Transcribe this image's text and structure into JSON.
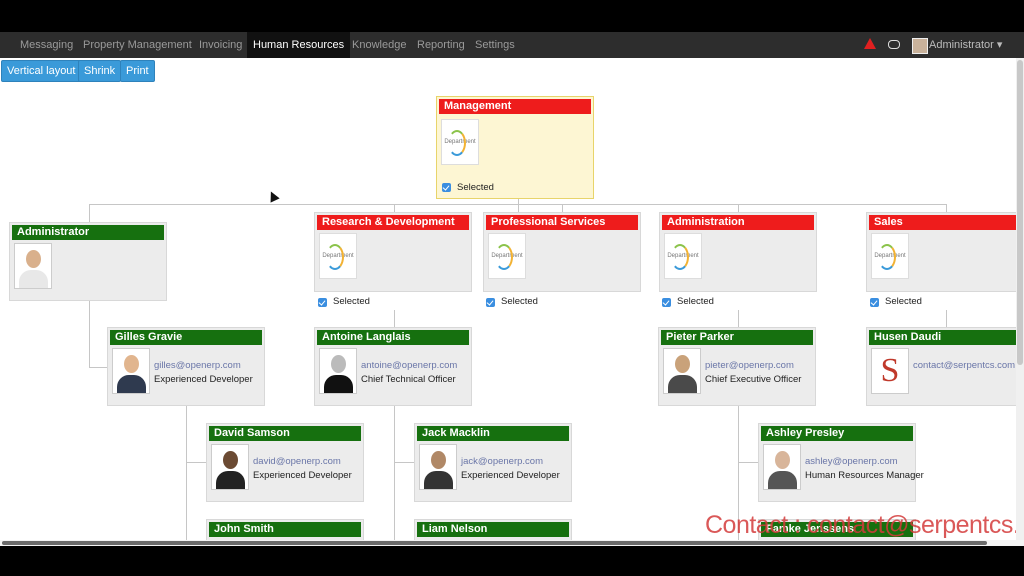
{
  "nav": {
    "items": [
      "Messaging",
      "Property Management",
      "Invoicing",
      "Human Resources",
      "Knowledge",
      "Reporting",
      "Settings"
    ],
    "active": "Human Resources",
    "user": "Administrator"
  },
  "toolbar": {
    "vertical_layout": "Vertical layout",
    "shrink": "Shrink",
    "print": "Print"
  },
  "departments": [
    {
      "name": "Management",
      "thumb_text": "Department",
      "selected_label": "Selected"
    },
    {
      "name": "Research & Development",
      "thumb_text": "Department",
      "selected_label": "Selected"
    },
    {
      "name": "Professional Services",
      "thumb_text": "Department",
      "selected_label": "Selected"
    },
    {
      "name": "Administration",
      "thumb_text": "Department",
      "selected_label": "Selected"
    },
    {
      "name": "Sales",
      "thumb_text": "Department",
      "selected_label": "Selected"
    }
  ],
  "employees": [
    {
      "name": "Administrator",
      "email": "",
      "job": ""
    },
    {
      "name": "Gilles Gravie",
      "email": "gilles@openerp.com",
      "job": "Experienced Developer"
    },
    {
      "name": "Antoine Langlais",
      "email": "antoine@openerp.com",
      "job": "Chief Technical Officer"
    },
    {
      "name": "Pieter Parker",
      "email": "pieter@openerp.com",
      "job": "Chief Executive Officer"
    },
    {
      "name": "Husen Daudi",
      "email": "contact@serpentcs.com",
      "job": ""
    },
    {
      "name": "David Samson",
      "email": "david@openerp.com",
      "job": "Experienced Developer"
    },
    {
      "name": "Jack Macklin",
      "email": "jack@openerp.com",
      "job": "Experienced Developer"
    },
    {
      "name": "Ashley Presley",
      "email": "ashley@openerp.com",
      "job": "Human Resources Manager"
    },
    {
      "name": "John Smith",
      "email": "",
      "job": ""
    },
    {
      "name": "Liam Nelson",
      "email": "",
      "job": ""
    },
    {
      "name": "Famke Jenssens",
      "email": "",
      "job": ""
    }
  ],
  "watermark": "Contact : contact@serpentcs.com",
  "colors": {
    "department_header": "#ee1c1c",
    "employee_header": "#16700f",
    "button": "#3a9ad9"
  }
}
